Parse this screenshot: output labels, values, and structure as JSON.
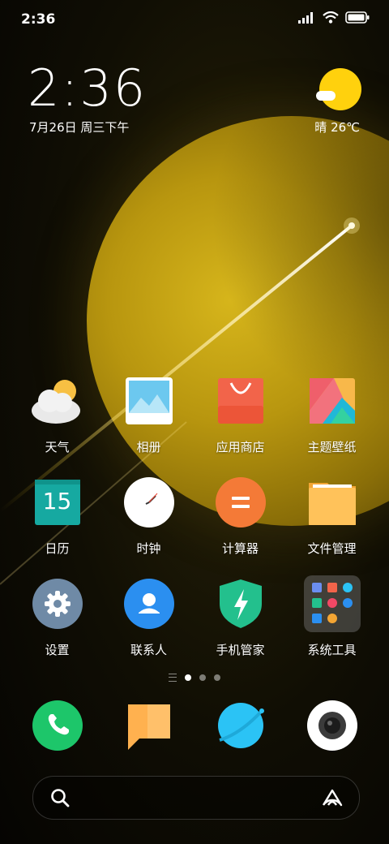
{
  "status": {
    "time": "2:36"
  },
  "widget": {
    "time": "2:36",
    "date": "7月26日 周三下午",
    "weather": "晴 26℃"
  },
  "apps": [
    {
      "label": "天气",
      "icon": "weather-icon"
    },
    {
      "label": "相册",
      "icon": "gallery-icon"
    },
    {
      "label": "应用商店",
      "icon": "app-store-icon"
    },
    {
      "label": "主题壁纸",
      "icon": "themes-icon"
    },
    {
      "label": "日历",
      "icon": "calendar-icon",
      "day": "15"
    },
    {
      "label": "时钟",
      "icon": "clock-icon"
    },
    {
      "label": "计算器",
      "icon": "calculator-icon"
    },
    {
      "label": "文件管理",
      "icon": "file-manager-icon"
    },
    {
      "label": "设置",
      "icon": "settings-icon"
    },
    {
      "label": "联系人",
      "icon": "contacts-icon"
    },
    {
      "label": "手机管家",
      "icon": "security-icon"
    },
    {
      "label": "系统工具",
      "icon": "system-tools-folder-icon"
    }
  ],
  "dock": [
    {
      "icon": "phone-icon"
    },
    {
      "icon": "messages-icon"
    },
    {
      "icon": "browser-icon"
    },
    {
      "icon": "camera-icon"
    }
  ],
  "pages": {
    "total": 3,
    "current": 1
  },
  "colors": {
    "accent_yellow": "#ffd10d",
    "phone_green": "#1dc66a",
    "browser_blue": "#2bc3f5"
  }
}
